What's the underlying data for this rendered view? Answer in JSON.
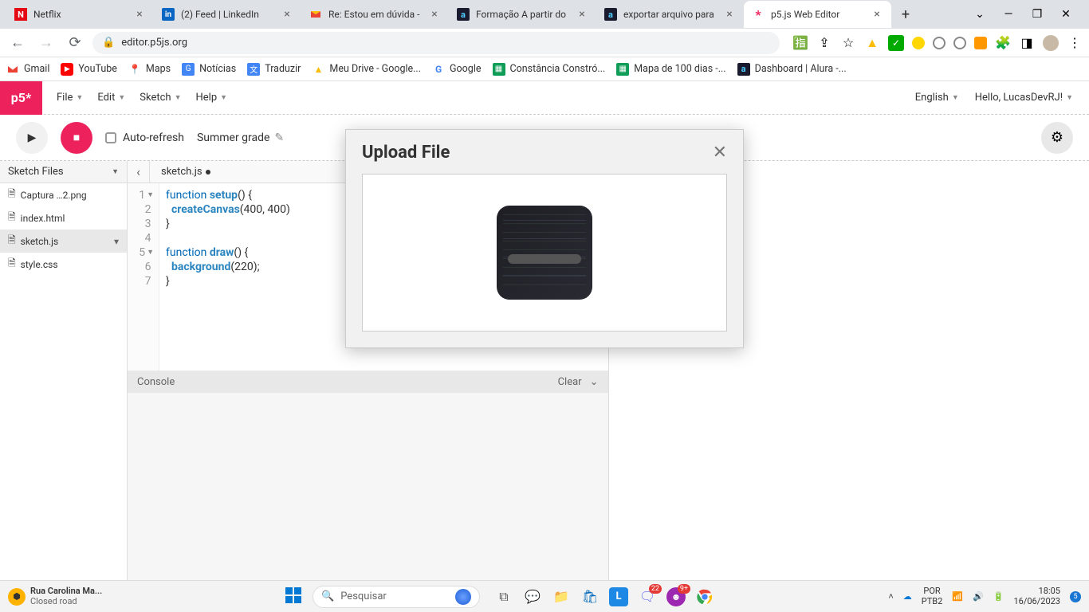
{
  "browser": {
    "tabs": [
      {
        "title": "Netflix",
        "favicon": "N"
      },
      {
        "title": "(2) Feed | LinkedIn",
        "favicon": "in"
      },
      {
        "title": "Re: Estou em dúvida -",
        "favicon": "M"
      },
      {
        "title": "Formação A partir do",
        "favicon": "a"
      },
      {
        "title": "exportar arquivo para",
        "favicon": "a"
      },
      {
        "title": "p5.js Web Editor",
        "favicon": "*",
        "active": true
      }
    ],
    "url": "editor.p5js.org",
    "bookmarks": [
      {
        "label": "Gmail",
        "icon": "M"
      },
      {
        "label": "YouTube",
        "icon": "▶"
      },
      {
        "label": "Maps",
        "icon": "📍"
      },
      {
        "label": "Notícias",
        "icon": "G"
      },
      {
        "label": "Traduzir",
        "icon": "G"
      },
      {
        "label": "Meu Drive - Google...",
        "icon": "▲"
      },
      {
        "label": "Google",
        "icon": "G"
      },
      {
        "label": "Constância Constró...",
        "icon": "▦"
      },
      {
        "label": "Mapa de 100 dias -...",
        "icon": "▦"
      },
      {
        "label": "Dashboard | Alura -...",
        "icon": "a"
      }
    ]
  },
  "editor": {
    "logo": "p5*",
    "menu": {
      "file": "File",
      "edit": "Edit",
      "sketch": "Sketch",
      "help": "Help"
    },
    "language": "English",
    "greeting": "Hello, LucasDevRJ!",
    "auto_refresh_label": "Auto-refresh",
    "sketch_name": "Summer grade",
    "sidebar_header": "Sketch Files",
    "files": [
      {
        "name": "Captura …2.png"
      },
      {
        "name": "index.html"
      },
      {
        "name": "sketch.js",
        "active": true
      },
      {
        "name": "style.css"
      }
    ],
    "active_tab": "sketch.js",
    "code_lines": {
      "l1_a": "function",
      "l1_b": "setup",
      "l1_c": "() {",
      "l2_a": "createCanvas",
      "l2_b": "(400, 400)",
      "l3": "}",
      "l4": "",
      "l5_a": "function",
      "l5_b": "draw",
      "l5_c": "() {",
      "l6_a": "background",
      "l6_b": "(220);",
      "l7": "}"
    },
    "console_label": "Console",
    "console_clear": "Clear"
  },
  "modal": {
    "title": "Upload File",
    "close": "✕"
  },
  "taskbar": {
    "weather_title": "Rua Carolina Ma...",
    "weather_sub": "Closed road",
    "search_placeholder": "Pesquisar",
    "badge_discord": "22",
    "badge_other": "9+",
    "lang_top": "POR",
    "lang_bottom": "PTB2",
    "time": "18:05",
    "date": "16/06/2023",
    "notif_badge": "5"
  }
}
